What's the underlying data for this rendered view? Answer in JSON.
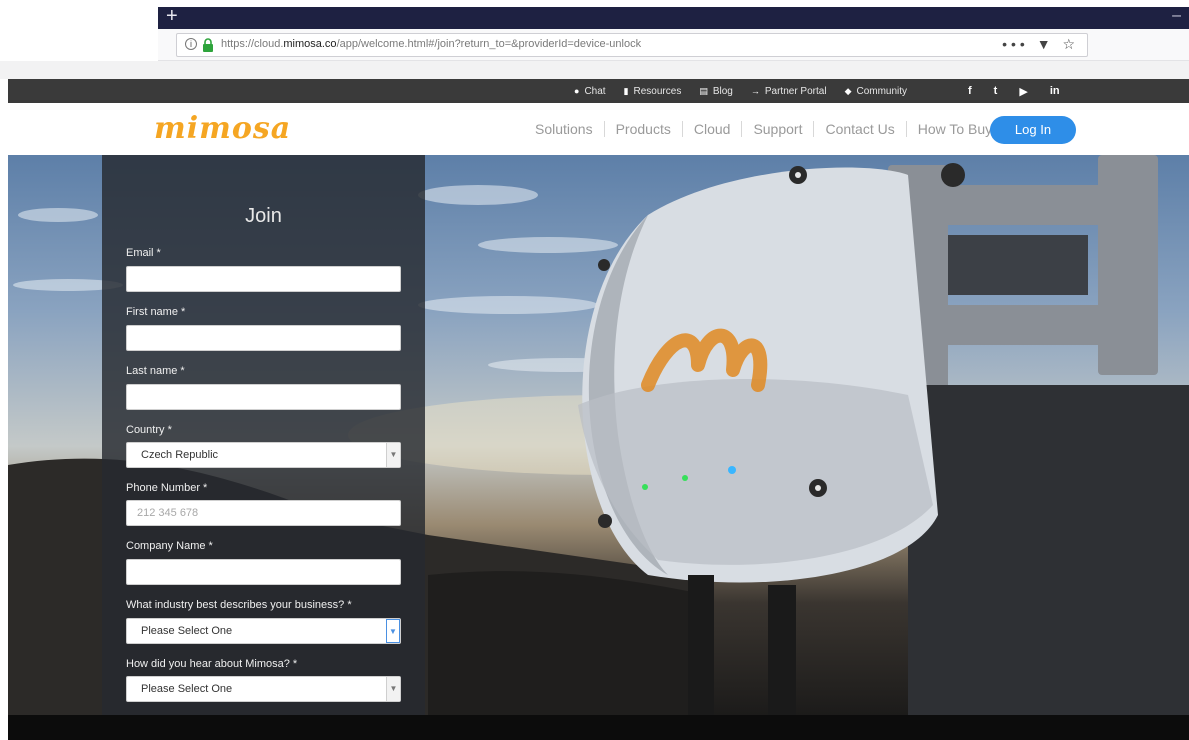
{
  "browser": {
    "url_prefix": "https://cloud.",
    "url_domain": "mimosa.co",
    "url_path": "/app/welcome.html#/join?return_to=&providerId=device-unlock",
    "more_icon": "•••",
    "pocket_icon": "▼",
    "bookmark_icon": "☆"
  },
  "topbar": {
    "links": [
      {
        "icon": "●",
        "label": "Chat"
      },
      {
        "icon": "▮",
        "label": "Resources"
      },
      {
        "icon": "▤",
        "label": "Blog"
      },
      {
        "icon": "→",
        "label": "Partner Portal"
      },
      {
        "icon": "◆",
        "label": "Community"
      }
    ],
    "social": [
      "f",
      "t",
      "▶",
      "in"
    ]
  },
  "nav": {
    "logo": "mimosa",
    "links": [
      "Solutions",
      "Products",
      "Cloud",
      "Support",
      "Contact Us",
      "How To Buy"
    ],
    "login": "Log In"
  },
  "form": {
    "title": "Join",
    "email_label": "Email  *",
    "first_name_label": "First name  *",
    "last_name_label": "Last name  *",
    "country_label": "Country  *",
    "country_value": "Czech Republic",
    "phone_label": "Phone Number  *",
    "phone_placeholder": "212 345 678",
    "company_label": "Company Name  *",
    "industry_label": "What industry best describes your business?  *",
    "industry_value": "Please Select One",
    "hear_label": "How did you hear about Mimosa?  *",
    "hear_value": "Please Select One"
  },
  "colors": {
    "brand_orange": "#f5a623",
    "login_blue": "#2e8ee8",
    "topbar_dark": "#3a3a3a",
    "tabstrip_navy": "#1e2142"
  }
}
